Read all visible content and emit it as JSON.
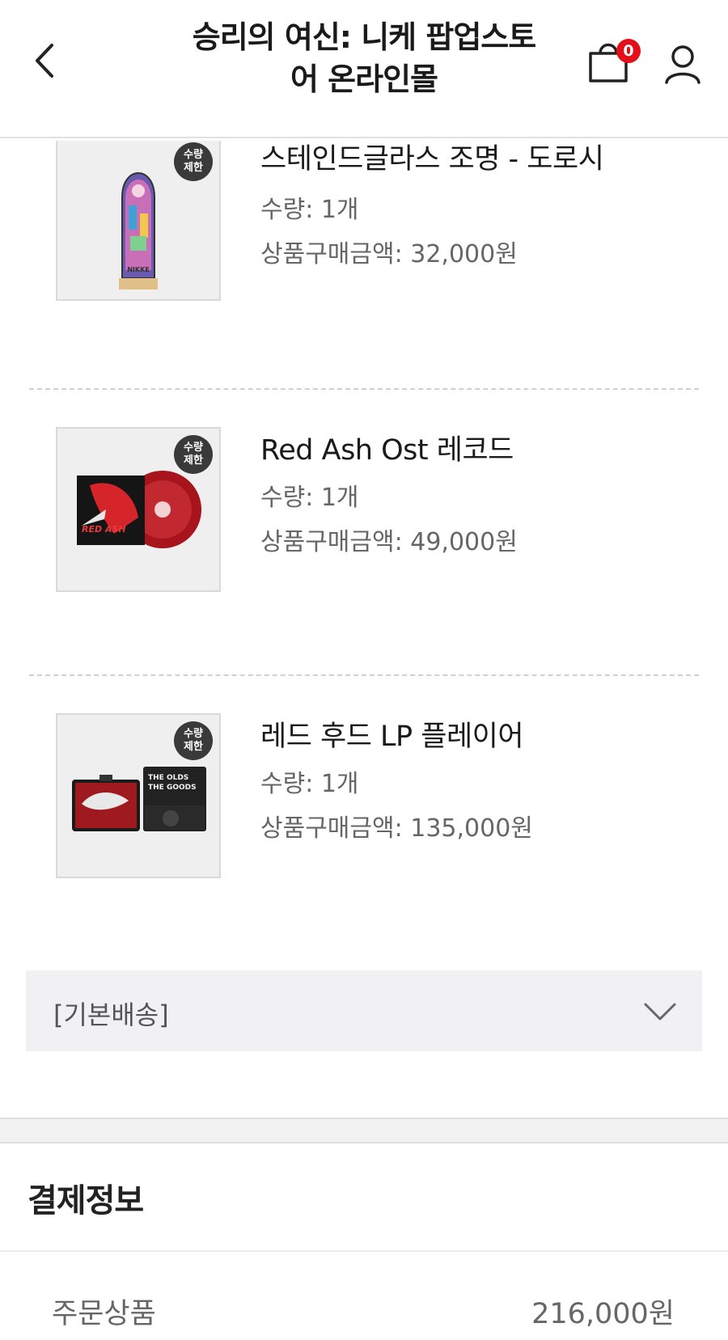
{
  "header": {
    "title_line1": "승리의 여신: 니케 팝업스토",
    "title_line2": "어 온라인몰",
    "cart_count": "0"
  },
  "products": [
    {
      "name": "스테인드글라스 조명 - 도로시",
      "qty": "수량: 1개",
      "price": "상품구매금액: 32,000원",
      "badge_line1": "수량",
      "badge_line2": "제한",
      "thumb_caption": "NIKKE"
    },
    {
      "name": "Red Ash Ost 레코드",
      "qty": "수량: 1개",
      "price": "상품구매금액: 49,000원",
      "badge_line1": "수량",
      "badge_line2": "제한",
      "thumb_caption": "RED ASH"
    },
    {
      "name": "레드 후드 LP 플레이어",
      "qty": "수량: 1개",
      "price": "상품구매금액: 135,000원",
      "badge_line1": "수량",
      "badge_line2": "제한",
      "thumb_caption": "THE OLDS THE GOODS"
    }
  ],
  "shipping": {
    "label": "[기본배송]"
  },
  "payment": {
    "title": "결제정보",
    "order_label": "주문상품",
    "order_value": "216,000원"
  },
  "colors": {
    "badge_red": "#e3101b",
    "badge_dark": "#3a3a3a",
    "shipping_bg": "#f1f1f3"
  },
  "icons": [
    "back-arrow-icon",
    "shopping-bag-icon",
    "user-icon",
    "chevron-down-icon"
  ]
}
